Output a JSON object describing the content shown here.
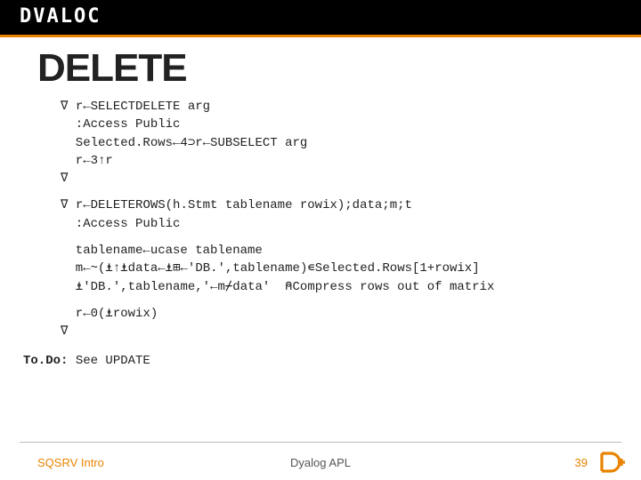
{
  "logo": "DVALOC",
  "title": "DELETE",
  "code": {
    "l1": "∇ r←SELECTDELETE arg",
    "l2": "  :Access Public",
    "l3": "  Selected.Rows←4⊃r←SUBSELECT arg",
    "l4": "  r←3↑r",
    "l5": "∇",
    "l6": "∇ r←DELETEROWS(h.Stmt tablename rowix);data;m;t",
    "l7": "  :Access Public",
    "l8": "  tablename←ucase tablename",
    "l9": "  m←~(⍎↑⍎data←⍎⊞←'DB.',tablename)∊Selected.Rows[1+rowix]",
    "l10": "  ⍎'DB.',tablename,'←m⌿data'  ⍝Compress rows out of matrix",
    "l11": "  r←0(⍎rowix)",
    "l12": "∇"
  },
  "todo_label": "To.Do:",
  "todo_text": " See UPDATE",
  "footer": {
    "left": "SQSRV Intro",
    "center": "Dyalog APL",
    "page": "39"
  }
}
